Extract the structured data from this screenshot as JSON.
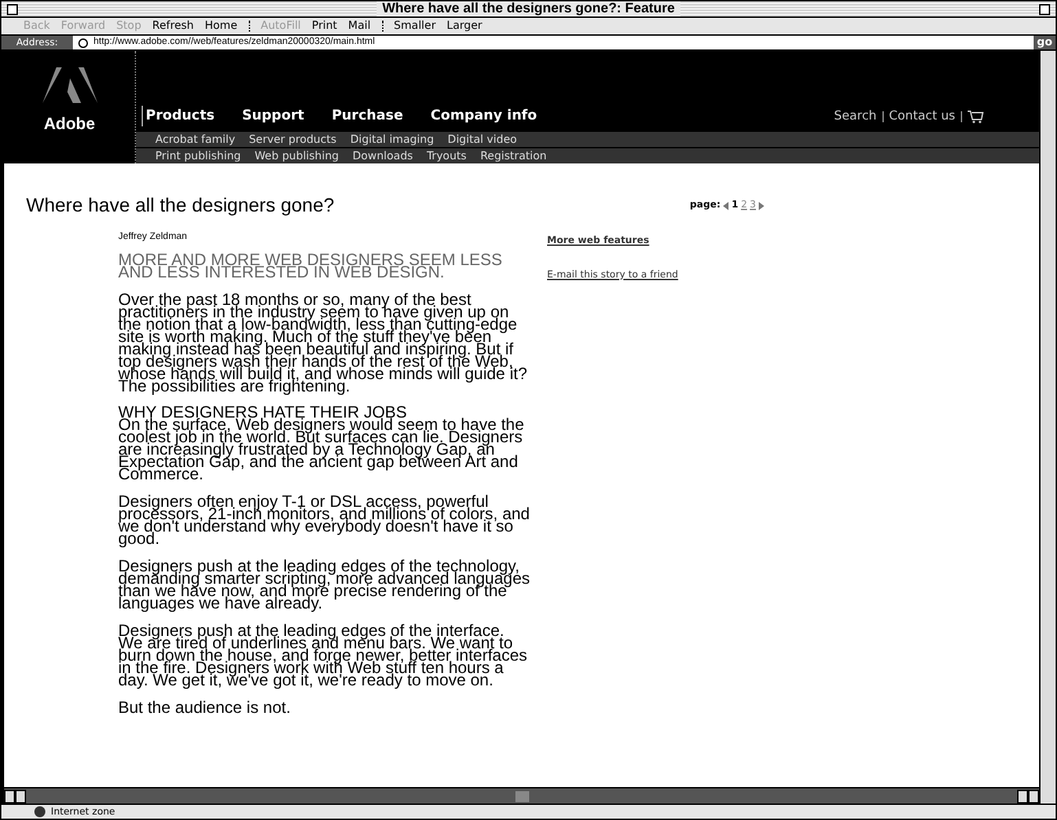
{
  "window": {
    "title": "Where have all the designers gone?: Feature"
  },
  "toolbar": {
    "groups": [
      [
        {
          "label": "Back",
          "disabled": true
        },
        {
          "label": "Forward",
          "disabled": true
        },
        {
          "label": "Stop",
          "disabled": true
        },
        {
          "label": "Refresh",
          "disabled": false
        },
        {
          "label": "Home",
          "disabled": false
        }
      ],
      [
        {
          "label": "AutoFill",
          "disabled": true
        },
        {
          "label": "Print",
          "disabled": false
        },
        {
          "label": "Mail",
          "disabled": false
        }
      ],
      [
        {
          "label": "Smaller",
          "disabled": false
        },
        {
          "label": "Larger",
          "disabled": false
        }
      ]
    ]
  },
  "address_bar": {
    "label": "Address:",
    "url": "http://www.adobe.com//web/features/zeldman20000320/main.html",
    "go": "go"
  },
  "site_header": {
    "logo_text": "Adobe",
    "primary_nav": [
      {
        "label": "Products",
        "selected": true
      },
      {
        "label": "Support",
        "selected": false
      },
      {
        "label": "Purchase",
        "selected": false
      },
      {
        "label": "Company info",
        "selected": false
      }
    ],
    "utility_links": [
      "Search",
      "Contact us"
    ],
    "sub_nav": [
      [
        "Acrobat family",
        "Server products",
        "Digital imaging",
        "Digital video"
      ],
      [
        "Print publishing",
        "Web publishing",
        "Downloads",
        "Tryouts",
        "Registration"
      ]
    ]
  },
  "article": {
    "title": "Where have all the designers gone?",
    "pager": {
      "label": "page:",
      "pages": [
        {
          "label": "1",
          "selected": true
        },
        {
          "label": "2",
          "selected": false
        },
        {
          "label": "3",
          "selected": false
        }
      ]
    },
    "byline": "Jeffrey Zeldman",
    "deck": "MORE AND MORE WEB DESIGNERS SEEM LESS AND LESS INTERESTED IN WEB DESIGN.",
    "paragraphs": [
      {
        "text": "Over the past 18 months or so, many of the best practitioners in the industry seem to have given up on the notion that a low-bandwidth, less than cutting-edge site is worth making. Much of the stuff they've been making instead has been beautiful and inspiring. But if top designers wash their hands of the rest of the Web, whose hands will build it, and whose minds will guide it? The possibilities are frightening."
      },
      {
        "heading": "WHY DESIGNERS HATE THEIR JOBS",
        "text": "On the surface, Web designers would seem to have the coolest job in the world. But surfaces can lie. Designers are increasingly frustrated by a Technology Gap, an Expectation Gap, and the ancient gap between Art and Commerce."
      },
      {
        "text": "Designers often enjoy T-1 or DSL access, powerful processors, 21-inch monitors, and millions of colors, and we don't understand why everybody doesn't have it so good."
      },
      {
        "text": "Designers push at the leading edges of the technology, demanding smarter scripting, more advanced languages than we have now, and more precise rendering of the languages we have already."
      },
      {
        "text": "Designers push at the leading edges of the interface. We are tired of underlines and menu bars. We want to burn down the house, and forge newer, better interfaces in the fire. Designers work with Web stuff ten hours a day. We get it, we've got it, we're ready to move on."
      },
      {
        "text": "But the audience is not."
      }
    ],
    "side_links": [
      "More web features",
      "E-mail this story to a friend"
    ]
  },
  "status_bar": {
    "text": "Internet zone"
  }
}
